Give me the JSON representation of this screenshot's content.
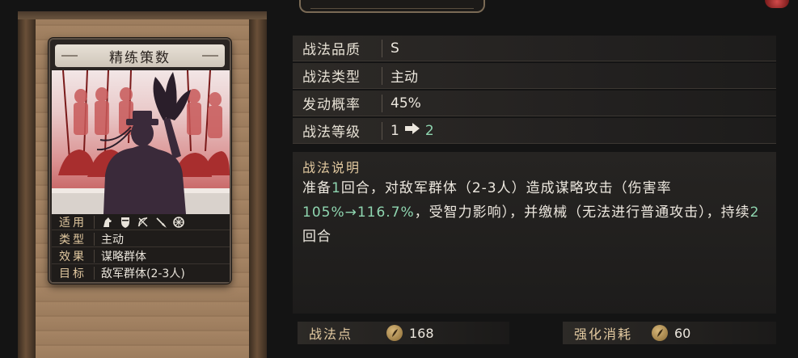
{
  "card": {
    "title": "精练策数",
    "stats": [
      {
        "key": "适用",
        "value": ""
      },
      {
        "key": "类型",
        "value": "主动"
      },
      {
        "key": "效果",
        "value": "谋略群体"
      },
      {
        "key": "目标",
        "value": "敌军群体(2-3人)"
      }
    ],
    "unit_icons": [
      "cavalry-icon",
      "shield-icon",
      "bow-icon",
      "spear-icon",
      "chariot-wheel-icon"
    ]
  },
  "info": {
    "quality_label": "战法品质",
    "quality_value": "S",
    "type_label": "战法类型",
    "type_value": "主动",
    "rate_label": "发动概率",
    "rate_value": "45%",
    "level_label": "战法等级",
    "level_from": "1",
    "level_to": "2"
  },
  "description": {
    "title": "战法说明",
    "part1": "准备",
    "num1": "1",
    "part2": "回合，对敌军群体（2-3人）造成谋略攻击（伤害率",
    "range": "105%→116.7%",
    "part3": "，受智力影响），并缴械（无法进行普通攻击），持续",
    "num2": "2",
    "part4": "回合"
  },
  "costs": {
    "points_label": "战法点",
    "points_value": "168",
    "upgrade_label": "强化消耗",
    "upgrade_value": "60"
  },
  "colors": {
    "accent_green": "#8fd6b0",
    "label_gold": "#e2c9a0",
    "art_red": "#b94545"
  }
}
